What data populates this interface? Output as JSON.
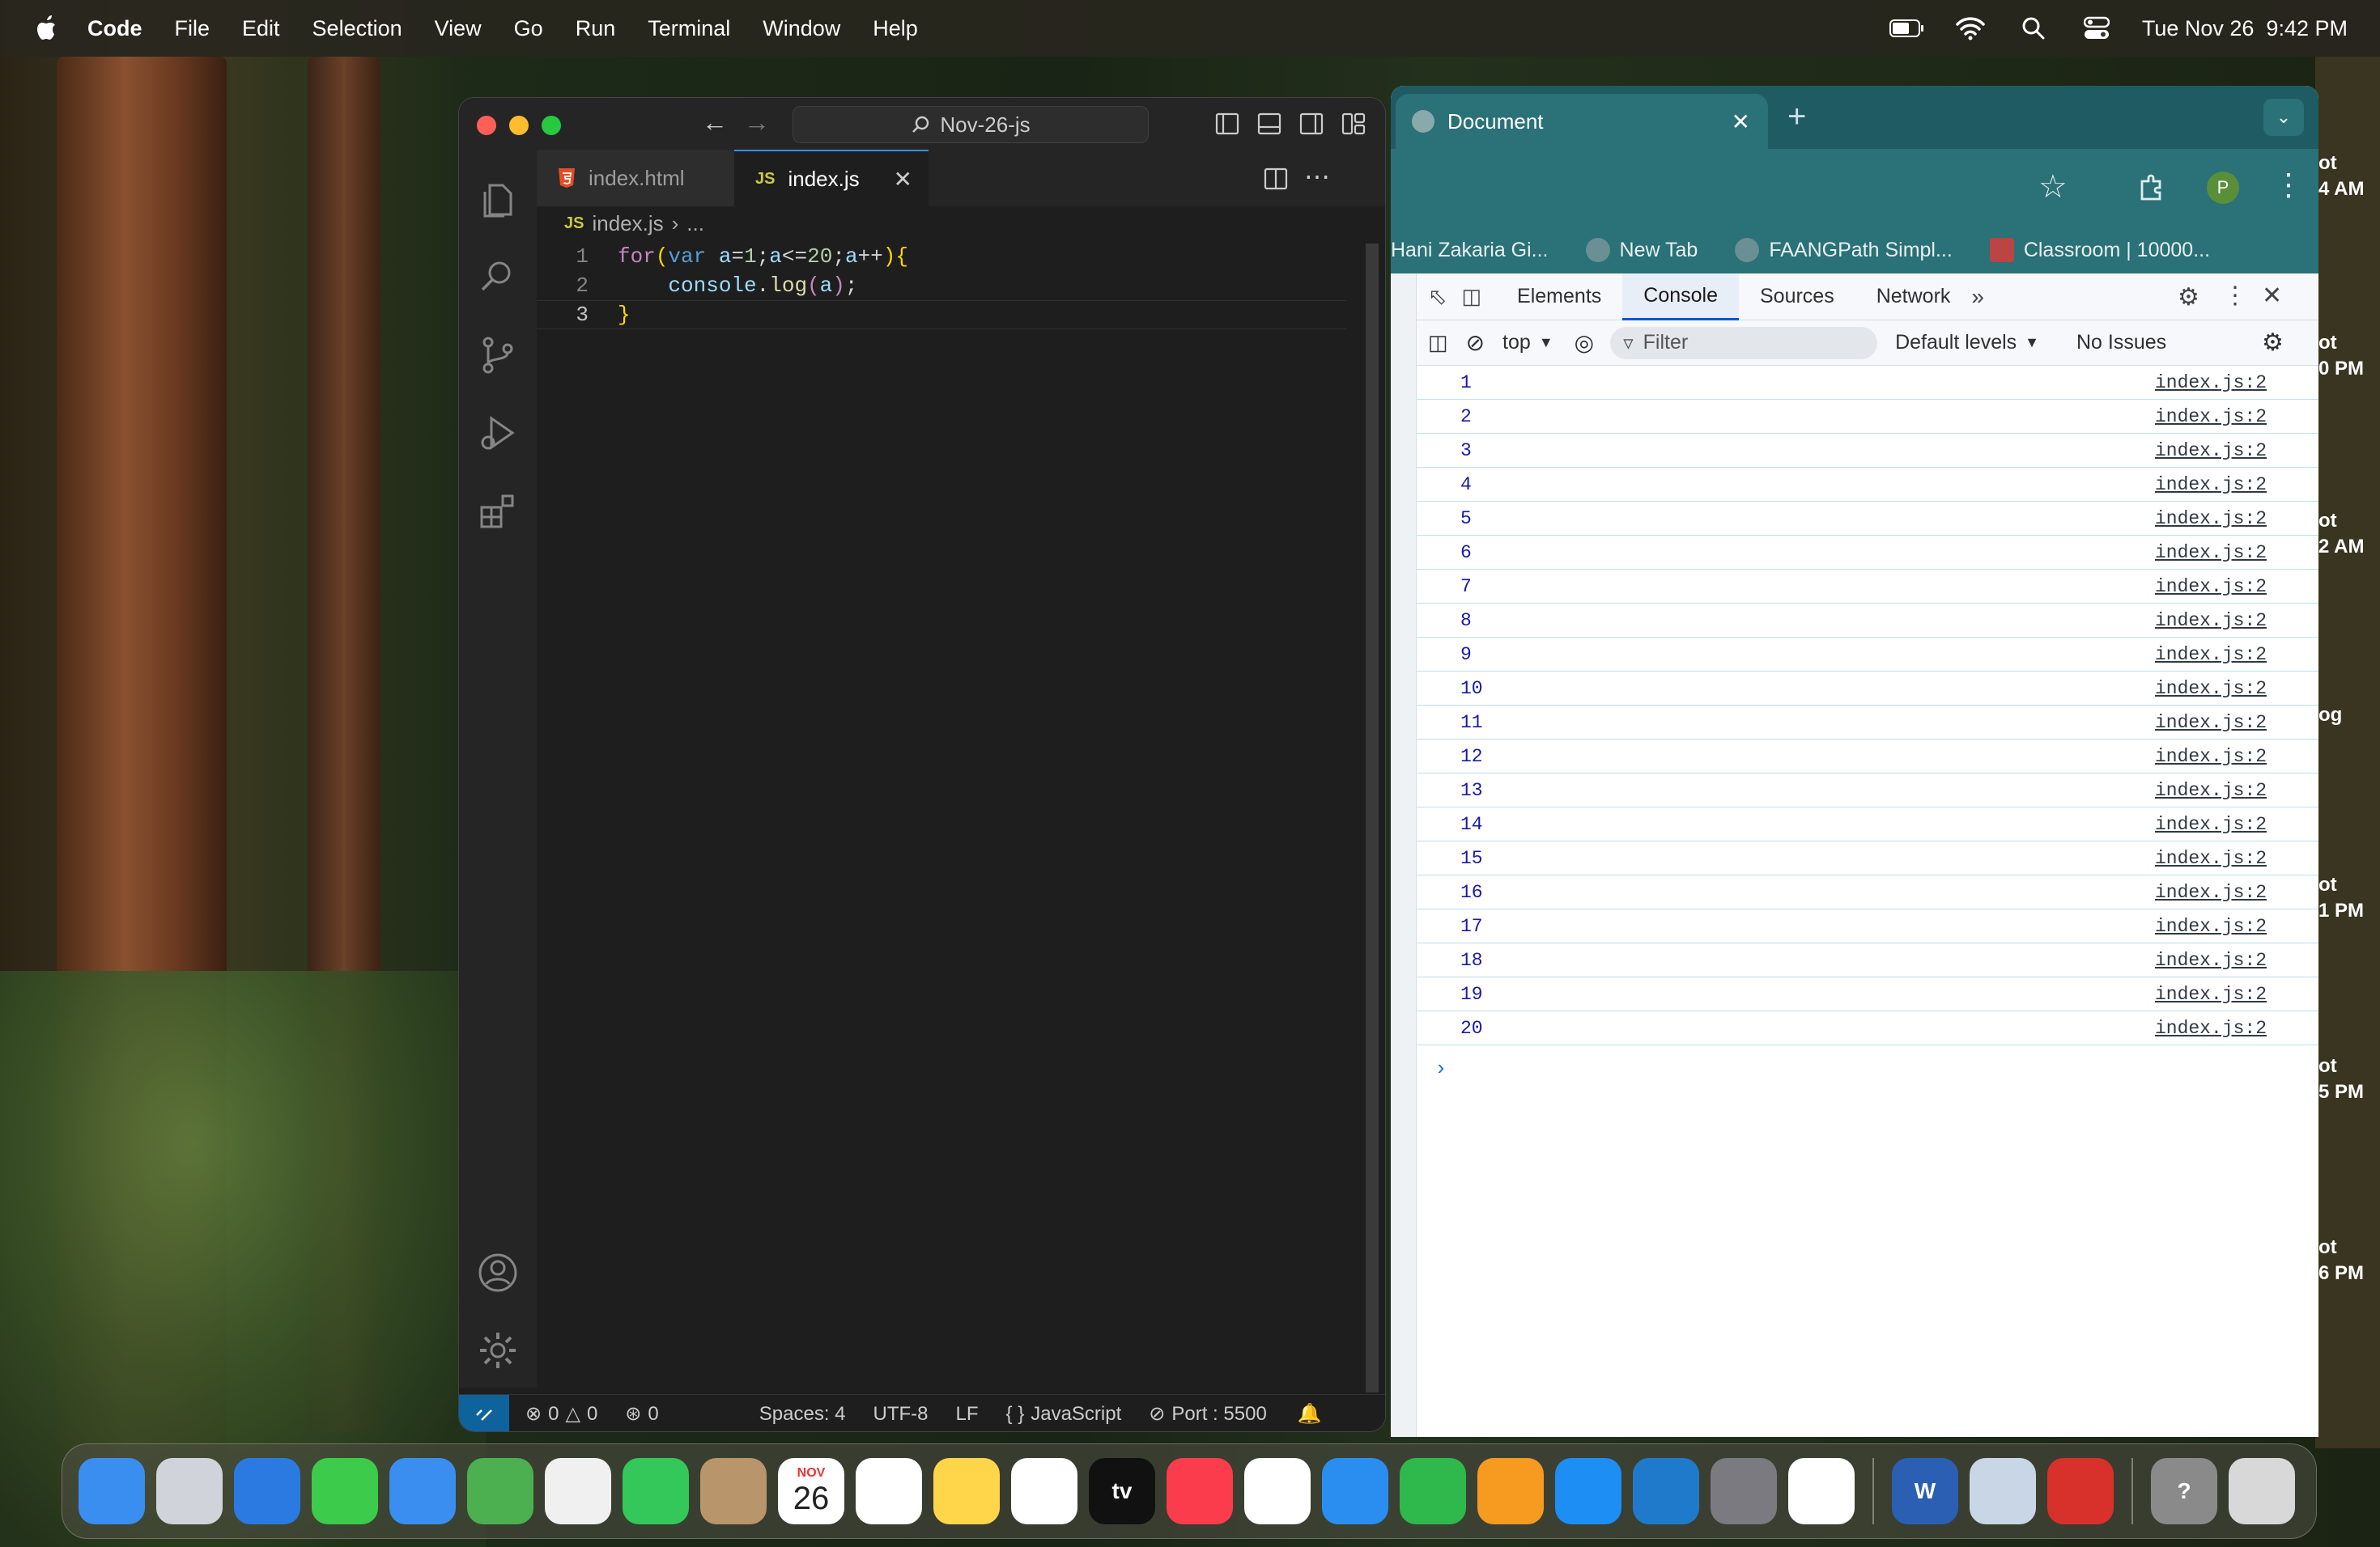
{
  "menubar": {
    "app": "Code",
    "items": [
      "File",
      "Edit",
      "Selection",
      "View",
      "Go",
      "Run",
      "Terminal",
      "Window",
      "Help"
    ],
    "clock": "Tue Nov 26  9:42 PM"
  },
  "vscode": {
    "search_text": "Nov-26-js",
    "tabs": [
      {
        "label": "index.html",
        "icon": "html5-icon",
        "active": false
      },
      {
        "label": "index.js",
        "icon": "JS",
        "active": true
      }
    ],
    "breadcrumb": {
      "badge": "JS",
      "file": "index.js",
      "rest": "..."
    },
    "code_lines": [
      {
        "num": "1",
        "text": "for(var a=1;a<=20;a++){"
      },
      {
        "num": "2",
        "text": "    console.log(a);"
      },
      {
        "num": "3",
        "text": "}"
      }
    ],
    "status": {
      "errors": "0",
      "warnings": "0",
      "ports": "0",
      "spaces": "Spaces: 4",
      "encoding": "UTF-8",
      "eol": "LF",
      "language": "JavaScript",
      "port": "Port : 5500"
    }
  },
  "chrome": {
    "tab_title": "Document",
    "bookmarks": [
      "Hani Zakaria Gi...",
      "New Tab",
      "FAANGPath Simpl...",
      "Classroom | 10000..."
    ],
    "profile_initial": "P",
    "devtools": {
      "tabs": [
        "Elements",
        "Console",
        "Sources",
        "Network"
      ],
      "active_tab": "Console",
      "context": "top",
      "filter_placeholder": "Filter",
      "levels": "Default levels",
      "issues": "No Issues",
      "logs": [
        {
          "value": "1",
          "source": "index.js:2"
        },
        {
          "value": "2",
          "source": "index.js:2"
        },
        {
          "value": "3",
          "source": "index.js:2"
        },
        {
          "value": "4",
          "source": "index.js:2"
        },
        {
          "value": "5",
          "source": "index.js:2"
        },
        {
          "value": "6",
          "source": "index.js:2"
        },
        {
          "value": "7",
          "source": "index.js:2"
        },
        {
          "value": "8",
          "source": "index.js:2"
        },
        {
          "value": "9",
          "source": "index.js:2"
        },
        {
          "value": "10",
          "source": "index.js:2"
        },
        {
          "value": "11",
          "source": "index.js:2"
        },
        {
          "value": "12",
          "source": "index.js:2"
        },
        {
          "value": "13",
          "source": "index.js:2"
        },
        {
          "value": "14",
          "source": "index.js:2"
        },
        {
          "value": "15",
          "source": "index.js:2"
        },
        {
          "value": "16",
          "source": "index.js:2"
        },
        {
          "value": "17",
          "source": "index.js:2"
        },
        {
          "value": "18",
          "source": "index.js:2"
        },
        {
          "value": "19",
          "source": "index.js:2"
        },
        {
          "value": "20",
          "source": "index.js:2"
        }
      ]
    }
  },
  "desktop_right_labels": [
    "ot",
    "4 AM",
    "ot",
    "0 PM",
    "ot",
    "2 AM",
    "og",
    "ot",
    "1 PM",
    "ot",
    "5 PM",
    "ot",
    "6 PM"
  ],
  "dock": {
    "calendar_month": "NOV",
    "calendar_day": "26",
    "apps": [
      {
        "name": "finder",
        "color": "#3a8ef0",
        "label": ""
      },
      {
        "name": "launchpad",
        "color": "#d0d4da",
        "label": ""
      },
      {
        "name": "safari",
        "color": "#2a7ae2",
        "label": ""
      },
      {
        "name": "messages",
        "color": "#3ccb4a",
        "label": ""
      },
      {
        "name": "mail",
        "color": "#3a8ef0",
        "label": ""
      },
      {
        "name": "maps",
        "color": "#4caf50",
        "label": ""
      },
      {
        "name": "photos",
        "color": "#f0f0f0",
        "label": ""
      },
      {
        "name": "facetime",
        "color": "#34c759",
        "label": ""
      },
      {
        "name": "contacts",
        "color": "#b8956a",
        "label": ""
      },
      {
        "name": "calendar",
        "color": "#ffffff",
        "label": ""
      },
      {
        "name": "reminders",
        "color": "#ffffff",
        "label": ""
      },
      {
        "name": "notes",
        "color": "#ffd54a",
        "label": ""
      },
      {
        "name": "freeform",
        "color": "#ffffff",
        "label": ""
      },
      {
        "name": "apple-tv",
        "color": "#111111",
        "label": "tv"
      },
      {
        "name": "music",
        "color": "#fa3c4c",
        "label": ""
      },
      {
        "name": "news",
        "color": "#ffffff",
        "label": ""
      },
      {
        "name": "keynote",
        "color": "#2a8df0",
        "label": ""
      },
      {
        "name": "numbers",
        "color": "#2fb84b",
        "label": ""
      },
      {
        "name": "pages",
        "color": "#f79a20",
        "label": ""
      },
      {
        "name": "app-store",
        "color": "#1c8ef4",
        "label": ""
      },
      {
        "name": "vscode",
        "color": "#1f7acc",
        "label": ""
      },
      {
        "name": "system-settings",
        "color": "#7a7a80",
        "label": ""
      },
      {
        "name": "chrome",
        "color": "#ffffff",
        "label": ""
      },
      {
        "name": "word",
        "color": "#2b5fb4",
        "label": "W"
      },
      {
        "name": "preview",
        "color": "#c8d6e6",
        "label": ""
      },
      {
        "name": "photo-booth",
        "color": "#d8302a",
        "label": ""
      },
      {
        "name": "help",
        "color": "#8a8a8a",
        "label": "?"
      },
      {
        "name": "trash",
        "color": "#d8d8d8",
        "label": ""
      }
    ]
  }
}
